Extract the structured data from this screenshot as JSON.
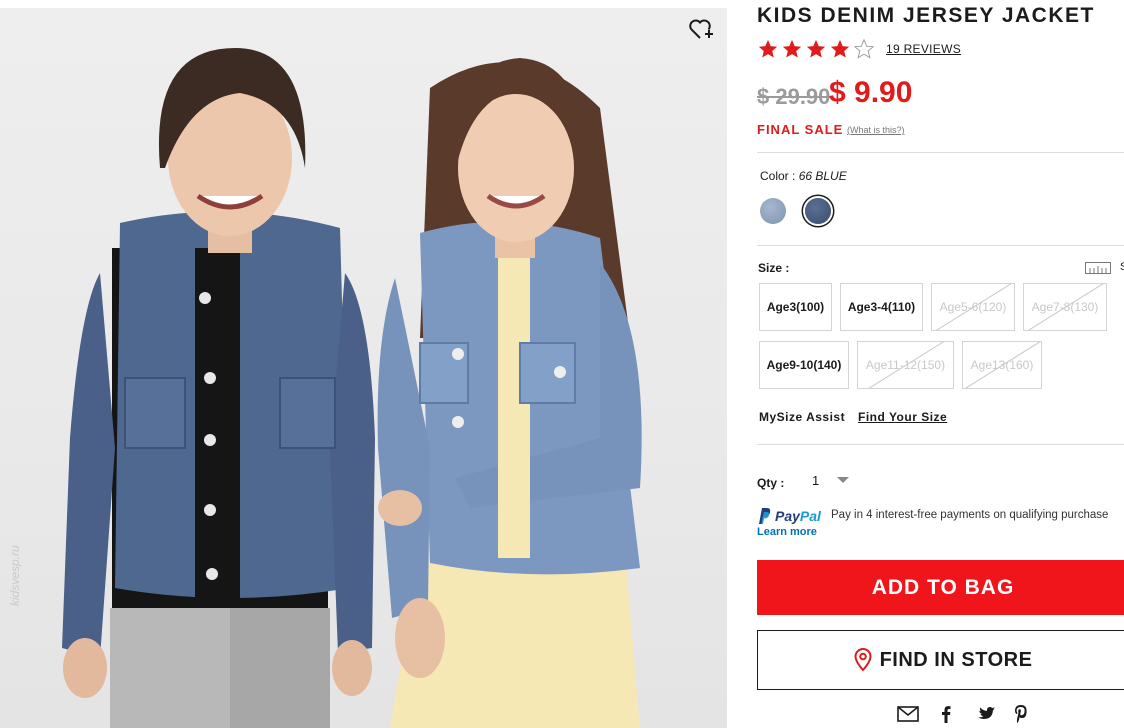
{
  "product": {
    "title": "KIDS DENIM JERSEY JACKET",
    "rating": 4,
    "rating_max": 5,
    "reviews_label": "19 REVIEWS",
    "price_original": "$ 29.90",
    "price_sale": "$ 9.90",
    "final_sale_label": "FINAL SALE",
    "what_is_this": "(What is this?)",
    "watermark": "kidsvesp.ru"
  },
  "color": {
    "label": "Color :",
    "selected": "66 BLUE",
    "swatches": [
      {
        "name": "light-blue",
        "hex": "#93a7c1"
      },
      {
        "name": "blue",
        "hex": "#4a5d82",
        "selected": true
      }
    ]
  },
  "size": {
    "label": "Size :",
    "guide_label": "S",
    "options": [
      {
        "label": "Age3(100)",
        "available": true
      },
      {
        "label": "Age3-4(110)",
        "available": true
      },
      {
        "label": "Age5-6(120)",
        "available": false
      },
      {
        "label": "Age7-8(130)",
        "available": false
      },
      {
        "label": "Age9-10(140)",
        "available": true
      },
      {
        "label": "Age11-12(150)",
        "available": false
      },
      {
        "label": "Age13(160)",
        "available": false
      }
    ]
  },
  "mysize": {
    "label": "MySize Assist",
    "link": "Find Your Size"
  },
  "qty": {
    "label": "Qty :",
    "value": "1"
  },
  "paypal": {
    "logo_a": "Pay",
    "logo_b": "Pal",
    "text": "Pay in 4 interest-free payments on qualifying purchase",
    "learn_more": "Learn more"
  },
  "actions": {
    "add_to_bag": "ADD TO BAG",
    "find_in_store": "FIND IN STORE"
  },
  "share": [
    "email-icon",
    "facebook-icon",
    "twitter-icon",
    "pinterest-icon"
  ],
  "colors": {
    "accent_red": "#e01b1b",
    "button_red": "#f0141b",
    "paypal_dark": "#253b80",
    "paypal_light": "#179bd7"
  }
}
